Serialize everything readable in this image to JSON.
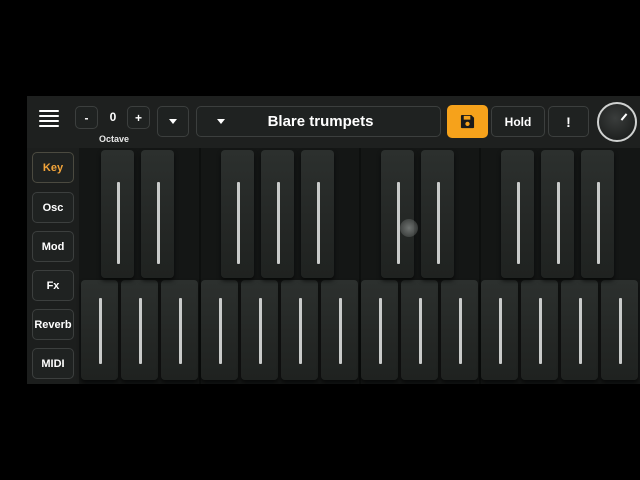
{
  "header": {
    "menu_icon": "hamburger-menu-icon",
    "octave": {
      "minus_label": "-",
      "value": "0",
      "plus_label": "+",
      "label": "Octave"
    },
    "preset": {
      "dropdown_icon": "chevron-down-icon",
      "name": "Blare trumpets"
    },
    "save_icon": "save-icon",
    "hold_label": "Hold",
    "alert_label": "!",
    "knob_icon": "volume-knob-icon"
  },
  "sidebar": {
    "items": [
      {
        "label": "Key",
        "active": true
      },
      {
        "label": "Osc"
      },
      {
        "label": "Mod"
      },
      {
        "label": "Fx"
      },
      {
        "label": "Reverb"
      },
      {
        "label": "MIDI"
      }
    ]
  },
  "colors": {
    "accent": "#f6a21b",
    "active_text": "#f2a43a",
    "background": "#1c1e1d"
  }
}
